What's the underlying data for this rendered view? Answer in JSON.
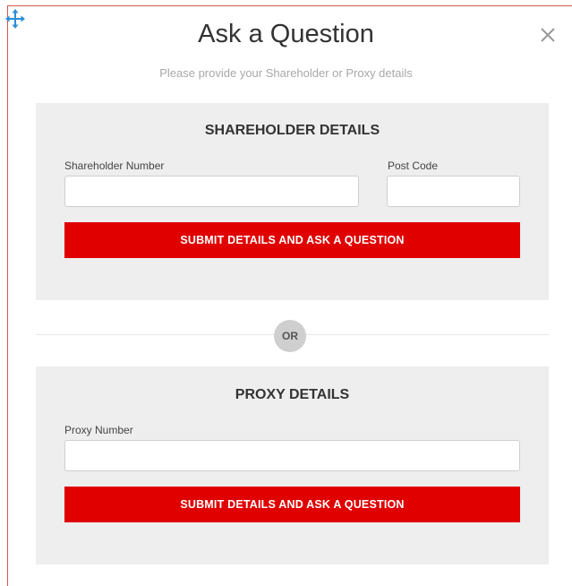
{
  "dialog": {
    "title": "Ask a Question",
    "subtitle": "Please provide your Shareholder or Proxy details",
    "close_icon": "close-icon",
    "move_icon": "move-icon"
  },
  "shareholder": {
    "heading": "SHAREHOLDER DETAILS",
    "number_label": "Shareholder Number",
    "number_value": "",
    "postcode_label": "Post Code",
    "postcode_value": "",
    "submit_label": "SUBMIT DETAILS AND ASK A QUESTION"
  },
  "separator": {
    "label": "OR"
  },
  "proxy": {
    "heading": "PROXY DETAILS",
    "number_label": "Proxy Number",
    "number_value": "",
    "submit_label": "SUBMIT DETAILS AND ASK A QUESTION"
  },
  "colors": {
    "accent": "#e00000",
    "panel_bg": "#eeeeee",
    "frame_border": "#d9534f",
    "move_icon": "#2a8fd8"
  }
}
